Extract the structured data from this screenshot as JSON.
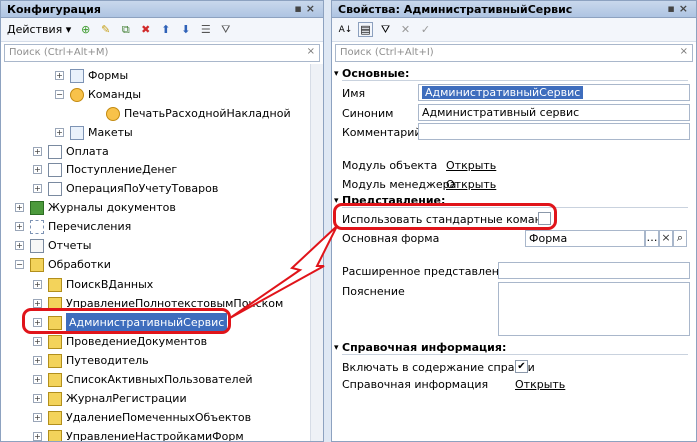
{
  "left": {
    "title": "Конфигурация",
    "actions_label": "Действия",
    "search_placeholder": "Поиск (Ctrl+Alt+M)",
    "tree": [
      {
        "label": "Формы",
        "exp": "+",
        "icon": "form"
      },
      {
        "label": "Команды",
        "exp": "−",
        "icon": "cmd"
      },
      {
        "label": "ПечатьРасходнойНакладной",
        "exp": "",
        "icon": "cmd"
      },
      {
        "label": "Макеты",
        "exp": "+",
        "icon": "form"
      },
      {
        "label": "Оплата",
        "exp": "+",
        "icon": "doc"
      },
      {
        "label": "ПоступлениеДенег",
        "exp": "+",
        "icon": "doc"
      },
      {
        "label": "ОперацияПоУчетуТоваров",
        "exp": "+",
        "icon": "doc"
      },
      {
        "label": "Журналы документов",
        "exp": "+",
        "icon": "journal"
      },
      {
        "label": "Перечисления",
        "exp": "+",
        "icon": "enum"
      },
      {
        "label": "Отчеты",
        "exp": "+",
        "icon": "report"
      },
      {
        "label": "Обработки",
        "exp": "−",
        "icon": "proc"
      },
      {
        "label": "ПоискВДанных",
        "exp": "+",
        "icon": "proc"
      },
      {
        "label": "УправлениеПолнотекстовымПоиском",
        "exp": "+",
        "icon": "proc"
      },
      {
        "label": "АдминистративныйСервис",
        "exp": "+",
        "icon": "proc"
      },
      {
        "label": "ПроведениеДокументов",
        "exp": "+",
        "icon": "proc"
      },
      {
        "label": "Путеводитель",
        "exp": "+",
        "icon": "proc"
      },
      {
        "label": "СписокАктивныхПользователей",
        "exp": "+",
        "icon": "proc"
      },
      {
        "label": "ЖурналРегистрации",
        "exp": "+",
        "icon": "proc"
      },
      {
        "label": "УдалениеПомеченныхОбъектов",
        "exp": "+",
        "icon": "proc"
      },
      {
        "label": "УправлениеНастройкамиФорм",
        "exp": "+",
        "icon": "proc"
      }
    ]
  },
  "right": {
    "title": "Свойства: АдминистративныйСервис",
    "search_placeholder": "Поиск (Ctrl+Alt+I)",
    "section_main": "Основные:",
    "name_label": "Имя",
    "name_value": "АдминистративныйСервис",
    "synonym_label": "Синоним",
    "synonym_value": "Административный сервис",
    "comment_label": "Комментарий",
    "object_module_label": "Модуль объекта",
    "manager_module_label": "Модуль менеджера",
    "open_link": "Открыть",
    "section_view": "Представление:",
    "use_std_commands_label": "Использовать стандартные коман",
    "main_form_label": "Основная форма",
    "main_form_value": "Форма",
    "ext_repr_label": "Расширенное представление",
    "explanation_label": "Пояснение",
    "section_help": "Справочная информация:",
    "include_help_label": "Включать в содержание справки",
    "include_help_check": "✔",
    "help_info_label": "Справочная информация"
  }
}
